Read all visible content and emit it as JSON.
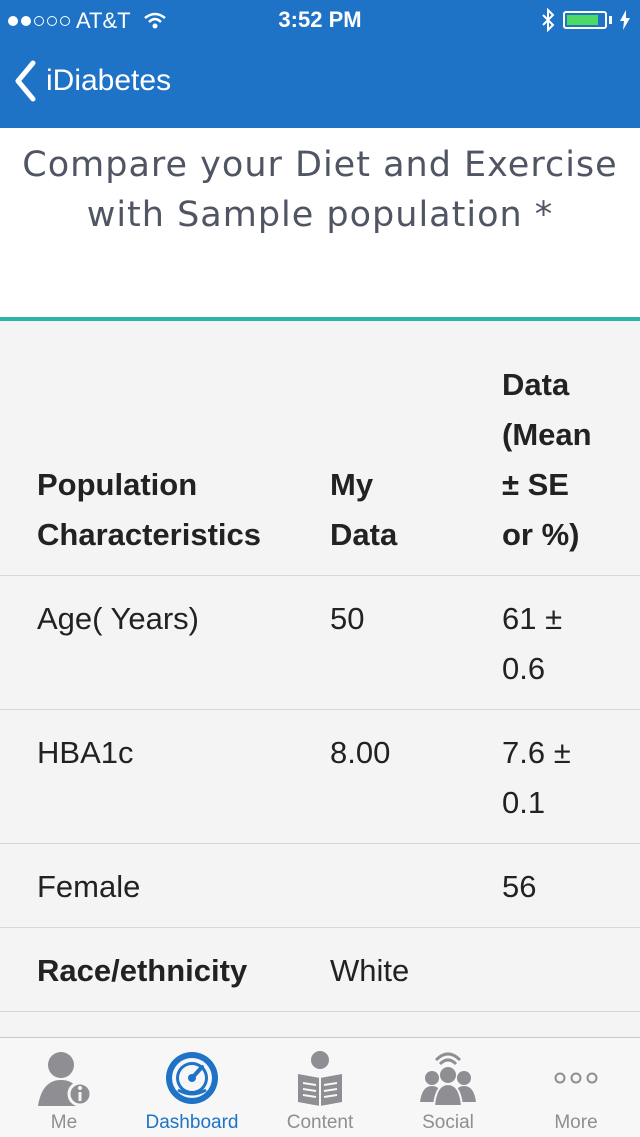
{
  "status_bar": {
    "carrier": "AT&T",
    "time": "3:52 PM"
  },
  "nav": {
    "back_label": "iDiabetes"
  },
  "heading": {
    "line1": "Compare your Diet and Exercise",
    "line2": "with Sample population *"
  },
  "table": {
    "headers": {
      "col1": [
        "Population",
        "Characteristics"
      ],
      "col2": [
        "My",
        "Data"
      ],
      "col3": [
        "Data",
        "(Mean",
        "± SE",
        "or %)"
      ]
    },
    "rows": [
      {
        "label": "Age( Years)",
        "my": "50",
        "data": [
          "61 ±",
          "0.6"
        ]
      },
      {
        "label": "HBA1c",
        "my": "8.00",
        "data": [
          "7.6 ±",
          "0.1"
        ]
      },
      {
        "label": "Female",
        "my": "",
        "data": [
          "56"
        ]
      },
      {
        "label": "Race/ethnicity",
        "my": "White",
        "data": []
      }
    ]
  },
  "tabs": [
    {
      "label": "Me",
      "icon": "person-info-icon"
    },
    {
      "label": "Dashboard",
      "icon": "speedometer-icon"
    },
    {
      "label": "Content",
      "icon": "newspaper-reader-icon"
    },
    {
      "label": "Social",
      "icon": "group-icon"
    },
    {
      "label": "More",
      "icon": "more-dots-icon"
    }
  ],
  "colors": {
    "accent": "#1f73c7",
    "divider": "#2ab5a8",
    "tab_inactive": "#8e8e93"
  }
}
